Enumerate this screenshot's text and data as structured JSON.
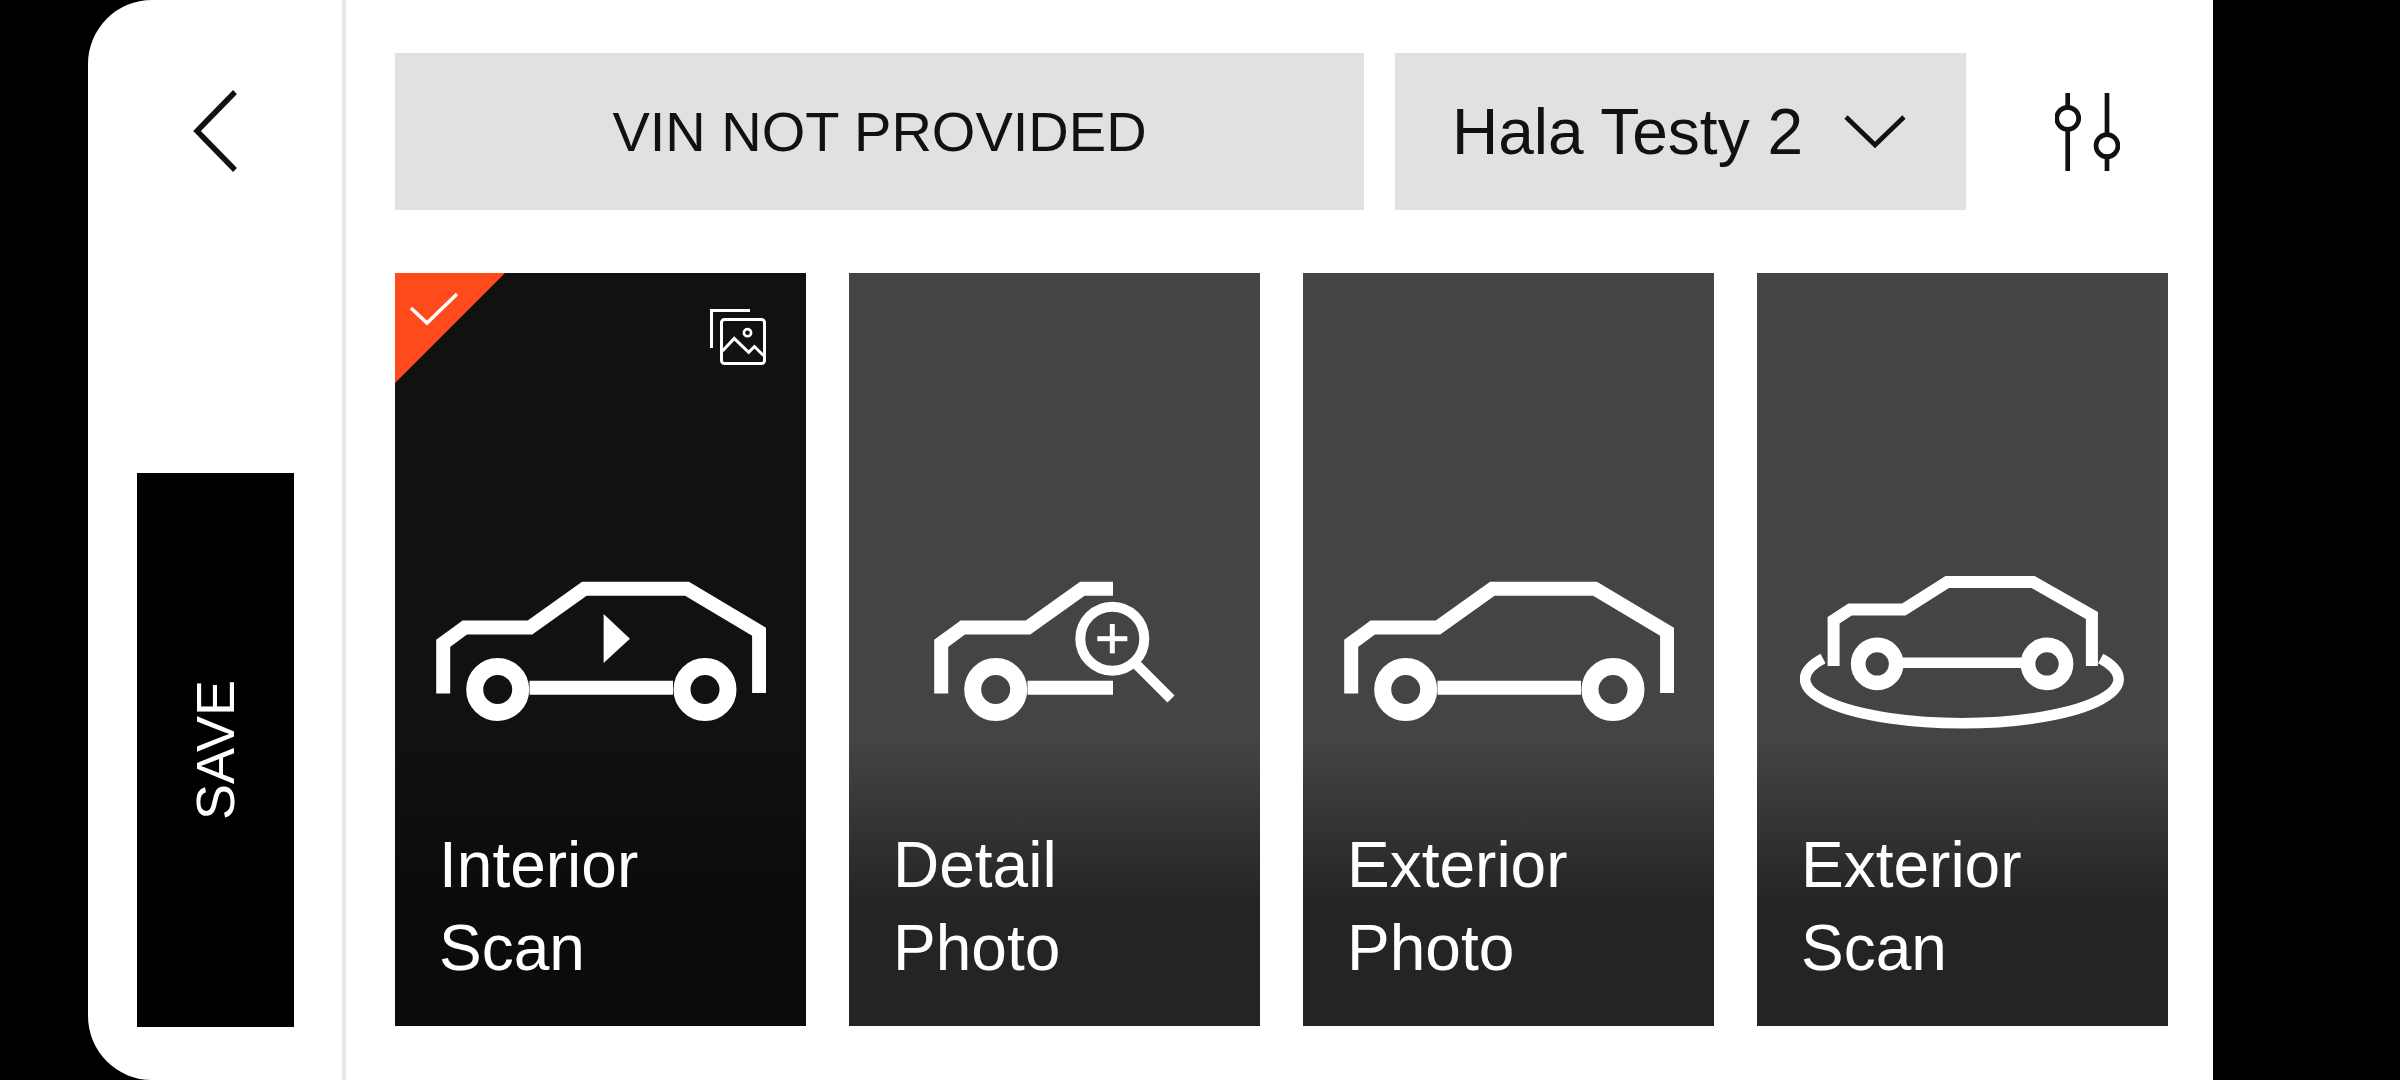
{
  "vin": "VIN NOT PROVIDED",
  "location_dropdown": {
    "value": "Hala Testy 2"
  },
  "save_label": "SAVE",
  "capture_modes": [
    {
      "kind": "interior",
      "label": "Interior Scan",
      "selected": true,
      "has_media": true
    },
    {
      "kind": "detail",
      "label": "Detail Photo",
      "selected": false,
      "has_media": false
    },
    {
      "kind": "exterior",
      "label": "Exterior Photo",
      "selected": false,
      "has_media": false
    },
    {
      "kind": "orbit",
      "label": "Exterior Scan",
      "selected": false,
      "has_media": false
    }
  ]
}
